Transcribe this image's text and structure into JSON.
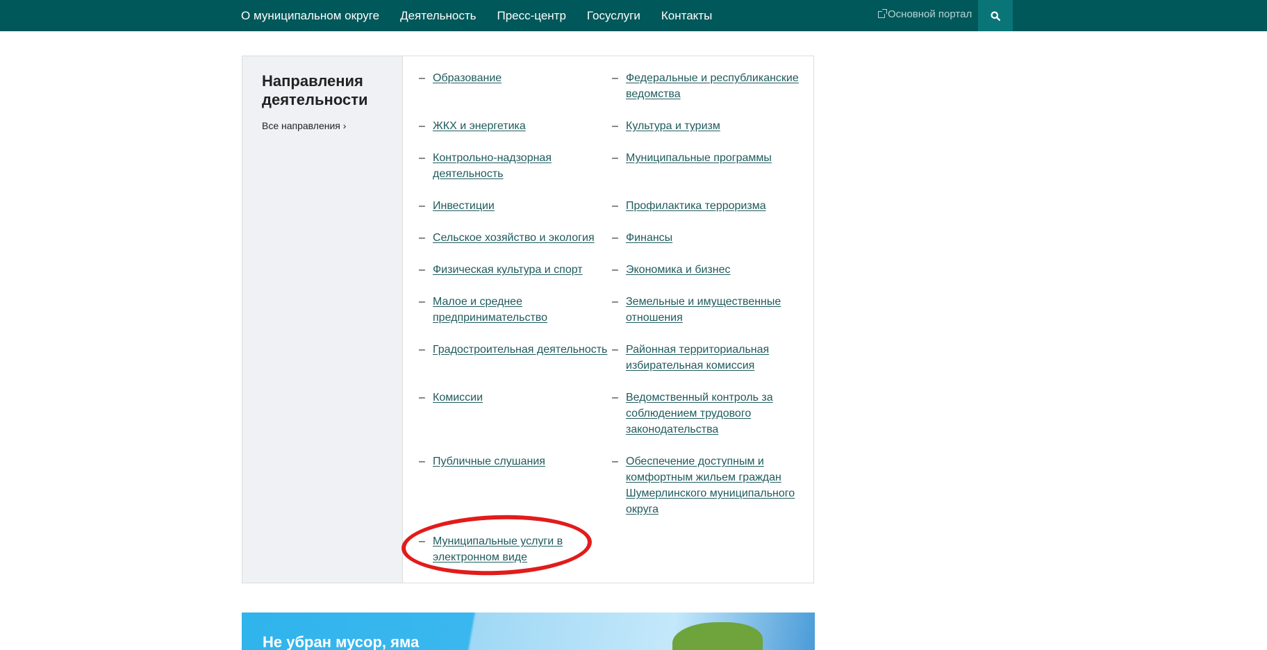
{
  "nav": {
    "items": [
      "О муниципальном округе",
      "Деятельность",
      "Пресс-центр",
      "Госуслуги",
      "Контакты"
    ],
    "portal_label": "Основной портал"
  },
  "panel": {
    "title": "Направления деятельности",
    "all_link": "Все направления ›",
    "links": [
      "Образование",
      "Федеральные и республиканские ведомства",
      "ЖКХ и энергетика",
      "Культура и туризм",
      "Контрольно-надзорная деятельность",
      "Муниципальные программы",
      "Инвестиции",
      "Профилактика терроризма",
      "Сельское хозяйство и экология",
      "Финансы",
      "Физическая культура и спорт",
      "Экономика и бизнес",
      "Малое и среднее предпринимательство",
      "Земельные и имущественные отношения",
      "Градостроительная деятельность",
      "Районная территориальная избирательная комиссия",
      "Комиссии",
      "Ведомственный контроль за соблюдением трудового законодательства",
      "Публичные слушания",
      "Обеспечение доступным и комфортным жильем граждан Шумерлинского муниципального округа",
      "Муниципальные услуги в электронном виде"
    ],
    "dash": "–"
  },
  "banner": {
    "title": "Не убран мусор, яма"
  },
  "colors": {
    "topbar": "#01585a",
    "search_button": "#0a7577",
    "link": "#1f5a5c",
    "highlight_circle": "#e21b1b"
  }
}
